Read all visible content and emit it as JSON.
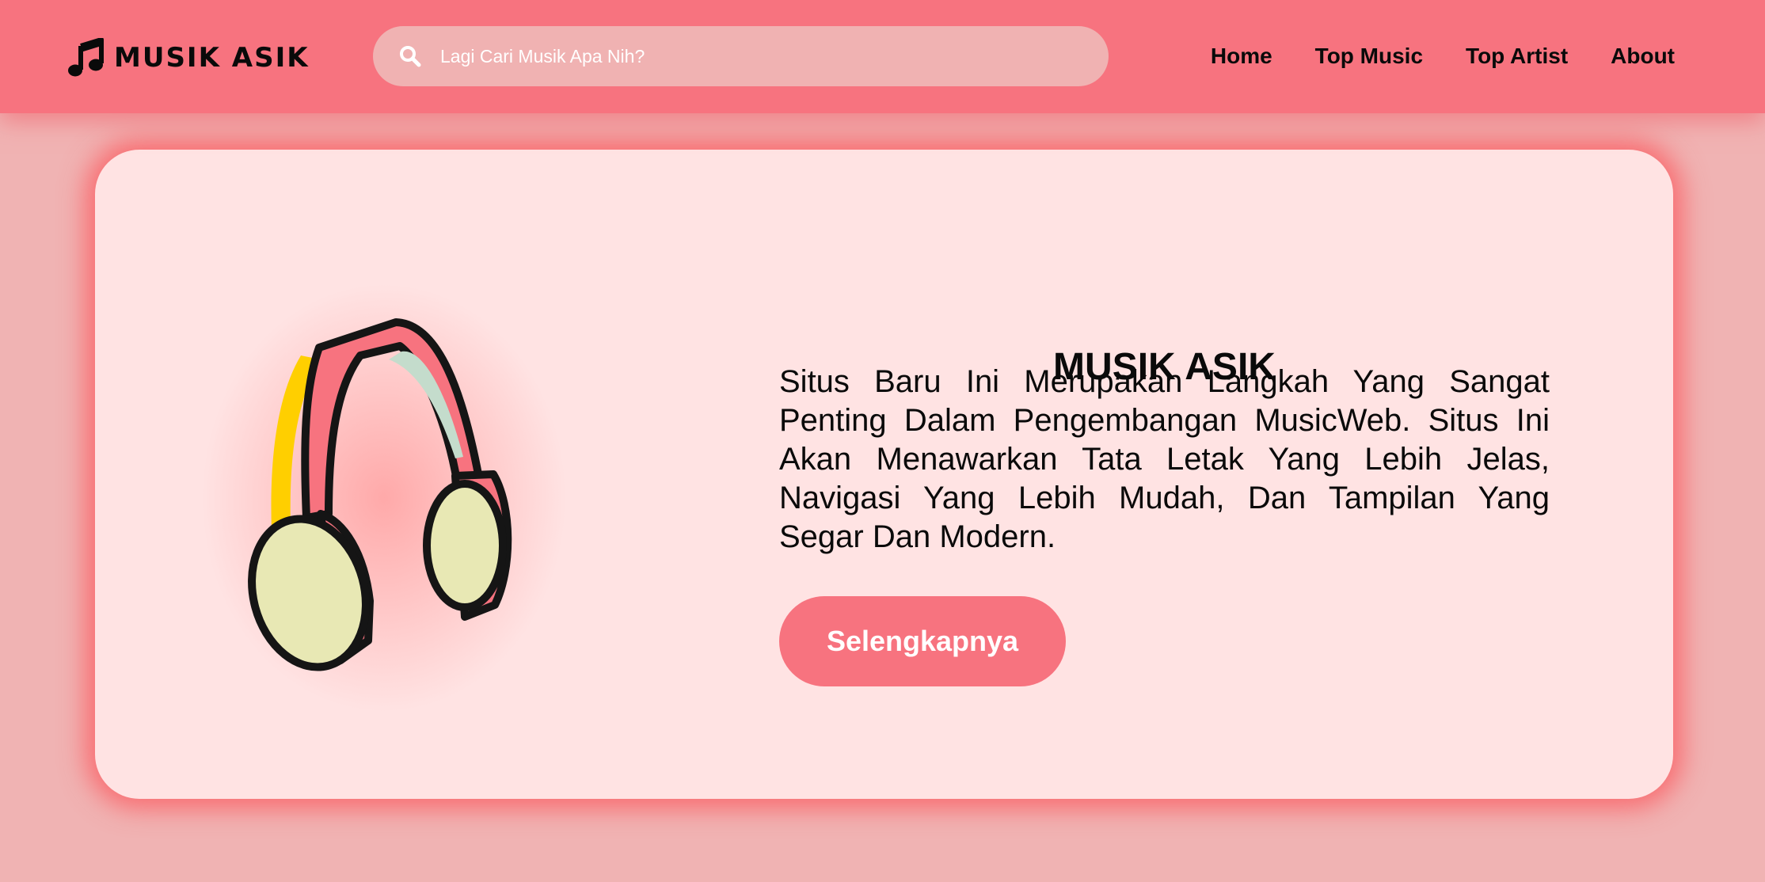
{
  "brand": {
    "name": "MUSIK ASIK",
    "icon": "music-note-icon"
  },
  "search": {
    "placeholder": "Lagi Cari Musik Apa Nih?",
    "value": "",
    "icon": "search-icon"
  },
  "nav": {
    "items": [
      {
        "label": "Home"
      },
      {
        "label": "Top Music"
      },
      {
        "label": "Top Artist"
      },
      {
        "label": "About"
      }
    ]
  },
  "hero": {
    "title": "MUSIK ASIK",
    "description": "Situs Baru Ini Merupakan Langkah Yang Sangat Penting Dalam Pengembangan MusicWeb. Situs Ini Akan Menawarkan Tata Letak Yang Lebih Jelas, Navigasi Yang Lebih Mudah, Dan Tampilan Yang Segar Dan Modern.",
    "button_label": "Selengkapnya",
    "illustration": "headphones-illustration"
  },
  "colors": {
    "page_background": "#f0b3b3",
    "navbar": "#f7737f",
    "search_background": "#f0b2b2",
    "card_background": "#ffe3e3",
    "button": "#f7737f",
    "card_glow": "#fa5f64",
    "text": "#0a0a0a"
  }
}
